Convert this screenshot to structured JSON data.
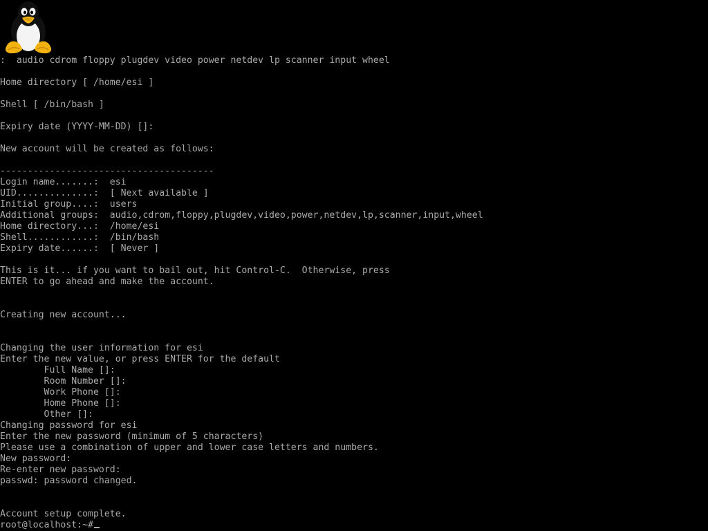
{
  "colors": {
    "background": "#000000",
    "foreground": "#aaaaaa"
  },
  "logo": {
    "icon": "tux-penguin-icon"
  },
  "console": {
    "lines": [
      ":  audio cdrom floppy plugdev video power netdev lp scanner input wheel",
      "",
      "Home directory [ /home/esi ]",
      "",
      "Shell [ /bin/bash ]",
      "",
      "Expiry date (YYYY-MM-DD) []:",
      "",
      "New account will be created as follows:",
      "",
      "---------------------------------------",
      "Login name.......:  esi",
      "UID..............:  [ Next available ]",
      "Initial group....:  users",
      "Additional groups:  audio,cdrom,floppy,plugdev,video,power,netdev,lp,scanner,input,wheel",
      "Home directory...:  /home/esi",
      "Shell............:  /bin/bash",
      "Expiry date......:  [ Never ]",
      "",
      "This is it... if you want to bail out, hit Control-C.  Otherwise, press",
      "ENTER to go ahead and make the account.",
      "",
      "",
      "Creating new account...",
      "",
      "",
      "Changing the user information for esi",
      "Enter the new value, or press ENTER for the default",
      "        Full Name []:",
      "        Room Number []:",
      "        Work Phone []:",
      "        Home Phone []:",
      "        Other []:",
      "Changing password for esi",
      "Enter the new password (minimum of 5 characters)",
      "Please use a combination of upper and lower case letters and numbers.",
      "New password:",
      "Re-enter new password:",
      "passwd: password changed.",
      "",
      "",
      "Account setup complete."
    ],
    "prompt": "root@localhost:~#"
  }
}
